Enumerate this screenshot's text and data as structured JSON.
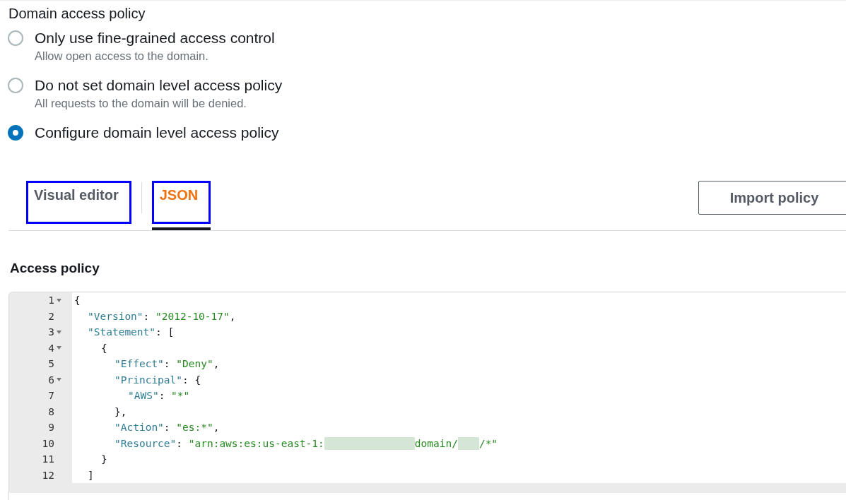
{
  "section_title": "Domain access policy",
  "options": [
    {
      "label": "Only use fine-grained access control",
      "description": "Allow open access to the domain.",
      "selected": false
    },
    {
      "label": "Do not set domain level access policy",
      "description": "All requests to the domain will be denied.",
      "selected": false
    },
    {
      "label": "Configure domain level access policy",
      "selected": true
    }
  ],
  "tabs": [
    {
      "label": "Visual editor",
      "selected": false,
      "annotated": true
    },
    {
      "label": "JSON",
      "selected": true,
      "annotated": true
    }
  ],
  "import_button": "Import policy",
  "editor": {
    "label": "Access policy",
    "lines": [
      {
        "number": "1",
        "foldable": true,
        "tokens": [
          {
            "kind": "punct",
            "text": "{"
          }
        ]
      },
      {
        "number": "2",
        "foldable": false,
        "tokens": [
          {
            "kind": "key",
            "text": "\"Version\""
          },
          {
            "kind": "punct",
            "text": ":"
          },
          {
            "kind": "string",
            "text": "\"2012-10-17\""
          },
          {
            "kind": "punct",
            "text": ","
          }
        ]
      },
      {
        "number": "3",
        "foldable": true,
        "tokens": [
          {
            "kind": "key",
            "text": "\"Statement\""
          },
          {
            "kind": "punct",
            "text": ":"
          },
          {
            "kind": "punct",
            "text": "["
          }
        ]
      },
      {
        "number": "4",
        "foldable": true,
        "tokens": [
          {
            "kind": "punct",
            "text": "{"
          }
        ]
      },
      {
        "number": "5",
        "foldable": false,
        "tokens": [
          {
            "kind": "key",
            "text": "\"Effect\""
          },
          {
            "kind": "punct",
            "text": ":"
          },
          {
            "kind": "string",
            "text": "\"Deny\""
          },
          {
            "kind": "punct",
            "text": ","
          }
        ]
      },
      {
        "number": "6",
        "foldable": true,
        "tokens": [
          {
            "kind": "key",
            "text": "\"Principal\""
          },
          {
            "kind": "punct",
            "text": ":"
          },
          {
            "kind": "punct",
            "text": "{"
          }
        ]
      },
      {
        "number": "7",
        "foldable": false,
        "tokens": [
          {
            "kind": "key",
            "text": "\"AWS\""
          },
          {
            "kind": "punct",
            "text": ":"
          },
          {
            "kind": "string",
            "text": "\"*\""
          }
        ]
      },
      {
        "number": "8",
        "foldable": false,
        "tokens": [
          {
            "kind": "punct",
            "text": "},"
          }
        ]
      },
      {
        "number": "9",
        "foldable": false,
        "tokens": [
          {
            "kind": "key",
            "text": "\"Action\""
          },
          {
            "kind": "punct",
            "text": ":"
          },
          {
            "kind": "string",
            "text": "\"es:*\""
          },
          {
            "kind": "punct",
            "text": ","
          }
        ]
      },
      {
        "number": "10",
        "foldable": false,
        "tokens": [
          {
            "kind": "key",
            "text": "\"Resource\""
          },
          {
            "kind": "punct",
            "text": ":"
          },
          {
            "kind": "string",
            "text": "\"arn:aws:es:us-east-1:"
          },
          {
            "kind": "redacted",
            "wide": true
          },
          {
            "kind": "string",
            "text": "domain/"
          },
          {
            "kind": "redacted",
            "wide": false
          },
          {
            "kind": "string",
            "text": "/*\""
          }
        ]
      },
      {
        "number": "11",
        "foldable": false,
        "tokens": [
          {
            "kind": "punct",
            "text": "}"
          }
        ]
      },
      {
        "number": "12",
        "foldable": false,
        "tokens": [
          {
            "kind": "punct",
            "text": "]"
          }
        ]
      }
    ]
  }
}
